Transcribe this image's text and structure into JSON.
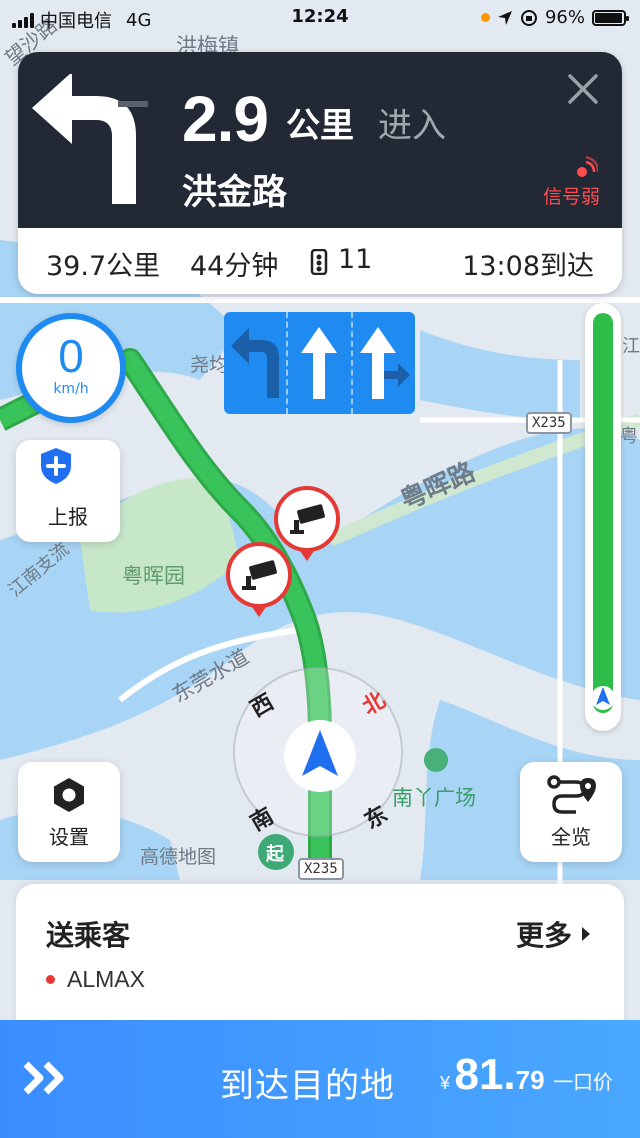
{
  "status_bar": {
    "carrier": "中国电信",
    "network": "4G",
    "time": "12:24",
    "battery": "96%",
    "battery_level": 0.96
  },
  "guidance": {
    "distance_value": "2.9",
    "distance_unit": "公里",
    "action": "进入",
    "road": "洪金路",
    "signal_status": "信号弱",
    "maneuver_icon": "turn-left-icon"
  },
  "trip": {
    "remaining_distance": "39.7公里",
    "remaining_time": "44分钟",
    "camera_count": "11",
    "arrival_time": "13:08到达"
  },
  "lanes": [
    "left-turn",
    "straight",
    "straight-right"
  ],
  "speed": {
    "value": "0",
    "unit": "km/h"
  },
  "buttons": {
    "report": "上报",
    "settings": "设置",
    "overview": "全览"
  },
  "map": {
    "road_label": "粤晖路",
    "places": [
      "洪梅镇",
      "尧均",
      "粤晖园",
      "东莞水道",
      "南丫广场",
      "高德地图",
      "江南支流",
      "望沙路"
    ],
    "shields": [
      "X235",
      "X235"
    ],
    "start_label": "起",
    "compass": {
      "west": "西",
      "north": "北",
      "east": "东",
      "south": "南"
    },
    "edge_labels": [
      "江",
      "粤"
    ]
  },
  "passenger": {
    "title": "送乘客",
    "more": "更多",
    "name": "ALMAX"
  },
  "action_bar": {
    "label": "到达目的地",
    "fare_currency": "¥",
    "fare_int": "81.",
    "fare_dec": "79",
    "fare_note": "一口价"
  },
  "colors": {
    "guidance_bg": "#222834",
    "accent_blue": "#1f8bf0",
    "route_green": "#2fbd4a",
    "warning_red": "#e53935"
  },
  "progress_remaining": 1.0
}
